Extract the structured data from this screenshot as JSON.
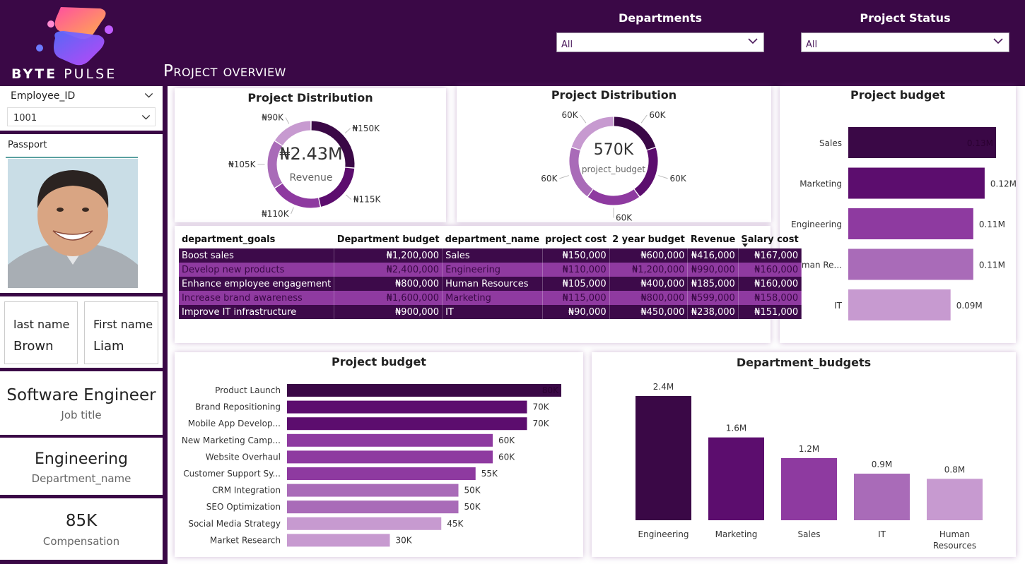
{
  "header": {
    "brand_left": "BYTE",
    "brand_right": "PULSE",
    "page_title": "Project overview"
  },
  "slicers": {
    "departments": {
      "label": "Departments",
      "value": "All"
    },
    "project_status": {
      "label": "Project Status",
      "value": "All"
    }
  },
  "employee": {
    "slicer_label": "Employee_ID",
    "slicer_value": "1001",
    "passport_label": "Passport",
    "last_name_label": "last name",
    "last_name": "Brown",
    "first_name_label": "First name",
    "first_name": "Liam",
    "job_title": "Software Engineer",
    "job_title_label": "Job title",
    "department": "Engineering",
    "department_label": "Department_name",
    "compensation": "85K",
    "compensation_label": "Compensation"
  },
  "colors": {
    "header_bg": "#3a0846",
    "shade_1": "#3a0846",
    "shade_2": "#5c0d6e",
    "shade_3": "#8e3aa0",
    "shade_4": "#a96bb8",
    "shade_5": "#c79ad0"
  },
  "donut_revenue": {
    "title": "Project Distribution",
    "center_value": "₦2.43M",
    "center_label": "Revenue",
    "slices": [
      {
        "label": "₦150K",
        "value": 150
      },
      {
        "label": "₦115K",
        "value": 115
      },
      {
        "label": "₦110K",
        "value": 110
      },
      {
        "label": "₦105K",
        "value": 105
      },
      {
        "label": "₦90K",
        "value": 90
      }
    ]
  },
  "donut_budget": {
    "title": "Project Distribution",
    "center_value": "570K",
    "center_label": "project_budget",
    "slices": [
      {
        "label": "60K",
        "value": 60
      },
      {
        "label": "60K",
        "value": 60
      },
      {
        "label": "60K",
        "value": 60
      },
      {
        "label": "60K",
        "value": 60
      },
      {
        "label": "60K",
        "value": 60
      }
    ]
  },
  "table": {
    "headers": [
      "department_goals",
      "Department budget",
      "department_name",
      "project cost",
      "2 year budget",
      "Revenue",
      "Salary cost"
    ],
    "rows": [
      [
        "Boost sales",
        "₦1,200,000",
        "Sales",
        "₦150,000",
        "₦600,000",
        "₦416,000",
        "₦167,000"
      ],
      [
        "Develop new products",
        "₦2,400,000",
        "Engineering",
        "₦110,000",
        "₦1,200,000",
        "₦990,000",
        "₦160,000"
      ],
      [
        "Enhance employee engagement",
        "₦800,000",
        "Human Resources",
        "₦105,000",
        "₦400,000",
        "₦185,000",
        "₦160,000"
      ],
      [
        "Increase brand awareness",
        "₦1,600,000",
        "Marketing",
        "₦115,000",
        "₦800,000",
        "₦599,000",
        "₦158,000"
      ],
      [
        "Improve IT infrastructure",
        "₦900,000",
        "IT",
        "₦90,000",
        "₦450,000",
        "₦238,000",
        "₦151,000"
      ]
    ]
  },
  "chart_data": [
    {
      "type": "pie",
      "title": "Project Distribution",
      "labels": [
        "₦150K",
        "₦115K",
        "₦110K",
        "₦105K",
        "₦90K"
      ],
      "values": [
        150000,
        115000,
        110000,
        105000,
        90000
      ]
    },
    {
      "type": "pie",
      "title": "Project Distribution",
      "labels": [
        "60K",
        "60K",
        "60K",
        "60K",
        "60K"
      ],
      "values": [
        60000,
        60000,
        60000,
        60000,
        60000
      ]
    },
    {
      "type": "bar",
      "orientation": "horizontal",
      "title": "Project budget",
      "categories": [
        "Sales",
        "Marketing",
        "Engineering",
        "Human Re...",
        "IT"
      ],
      "values": [
        0.13,
        0.12,
        0.11,
        0.11,
        0.09
      ],
      "labels": [
        "0.13M",
        "0.12M",
        "0.11M",
        "0.11M",
        "0.09M"
      ],
      "unit": "M"
    },
    {
      "type": "bar",
      "orientation": "horizontal",
      "title": "Project budget",
      "categories": [
        "Product Launch",
        "Brand Repositioning",
        "Mobile App Develop...",
        "New Marketing Camp...",
        "Website Overhaul",
        "Customer Support Sy...",
        "CRM Integration",
        "SEO Optimization",
        "Social Media Strategy",
        "Market Research"
      ],
      "values": [
        80,
        70,
        70,
        60,
        60,
        55,
        50,
        50,
        45,
        30
      ],
      "labels": [
        "80K",
        "70K",
        "70K",
        "60K",
        "60K",
        "55K",
        "50K",
        "50K",
        "45K",
        "30K"
      ],
      "unit": "K"
    },
    {
      "type": "bar",
      "orientation": "vertical",
      "title": "Department_budgets",
      "categories": [
        "Engineering",
        "Marketing",
        "Sales",
        "IT",
        "Human Resources"
      ],
      "values": [
        2.4,
        1.6,
        1.2,
        0.9,
        0.8
      ],
      "labels": [
        "2.4M",
        "1.6M",
        "1.2M",
        "0.9M",
        "0.8M"
      ],
      "unit": "M"
    }
  ]
}
